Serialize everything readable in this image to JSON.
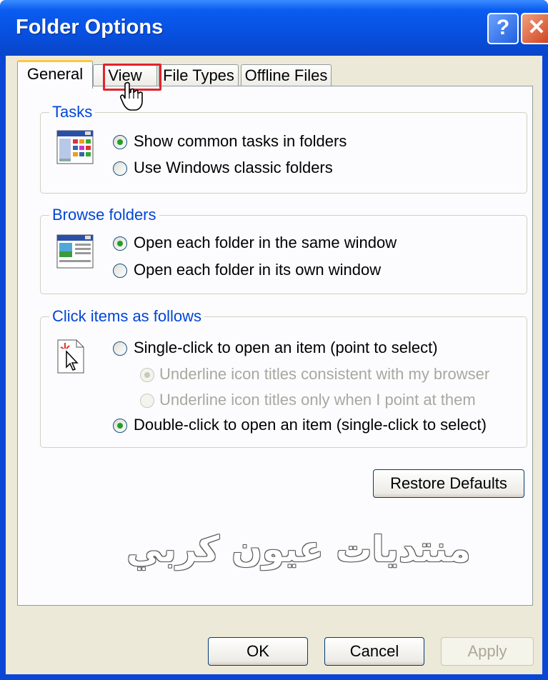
{
  "window": {
    "title": "Folder Options"
  },
  "titlebar": {
    "help_label": "?",
    "close_label": "✕",
    "help_icon": "help-icon",
    "close_icon": "close-icon"
  },
  "tabs": [
    {
      "label": "General",
      "active": true
    },
    {
      "label": "View",
      "active": false
    },
    {
      "label": "File Types",
      "active": false
    },
    {
      "label": "Offline Files",
      "active": false
    }
  ],
  "tasks": {
    "legend": "Tasks",
    "options": [
      {
        "label": "Show common tasks in folders",
        "selected": true
      },
      {
        "label": "Use Windows classic folders",
        "selected": false
      }
    ]
  },
  "browse": {
    "legend": "Browse folders",
    "options": [
      {
        "label": "Open each folder in the same window",
        "selected": true
      },
      {
        "label": "Open each folder in its own window",
        "selected": false
      }
    ]
  },
  "click": {
    "legend": "Click items as follows",
    "options": [
      {
        "label": "Single-click to open an item (point to select)",
        "selected": false
      },
      {
        "label": "Underline icon titles consistent with my browser",
        "selected": true,
        "disabled": true
      },
      {
        "label": "Underline icon titles only when I point at them",
        "selected": false,
        "disabled": true
      },
      {
        "label": "Double-click to open an item (single-click to select)",
        "selected": true
      }
    ]
  },
  "buttons": {
    "restore": "Restore Defaults",
    "ok": "OK",
    "cancel": "Cancel",
    "apply": "Apply"
  },
  "watermark": "منتديات عيون كربي",
  "colors": {
    "titlebar": "#0a5ae6",
    "accent_legend": "#0046d5",
    "radio_dot": "#21a121",
    "highlight": "#e0242c"
  }
}
